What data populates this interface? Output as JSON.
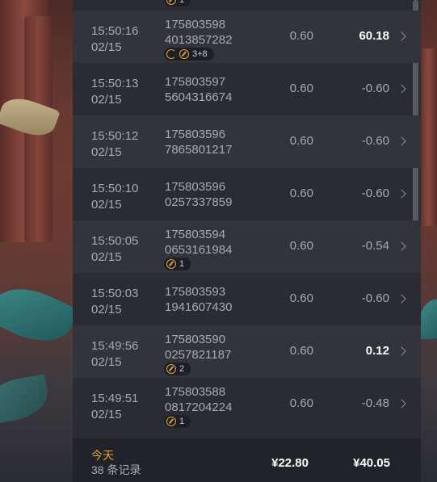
{
  "rows": [
    {
      "time": "15:50:16",
      "date": "02/15",
      "id_line1": "175803598",
      "id_line2": "4013857282",
      "bet": "0.60",
      "pl": "60.18",
      "pl_positive": true,
      "badge": "3+8",
      "badge_refresh": true
    },
    {
      "time": "15:50:13",
      "date": "02/15",
      "id_line1": "175803597",
      "id_line2": "5604316674",
      "bet": "0.60",
      "pl": "-0.60",
      "pl_positive": false
    },
    {
      "time": "15:50:12",
      "date": "02/15",
      "id_line1": "175803596",
      "id_line2": "7865801217",
      "bet": "0.60",
      "pl": "-0.60",
      "pl_positive": false
    },
    {
      "time": "15:50:10",
      "date": "02/15",
      "id_line1": "175803596",
      "id_line2": "0257337859",
      "bet": "0.60",
      "pl": "-0.60",
      "pl_positive": false
    },
    {
      "time": "15:50:05",
      "date": "02/15",
      "id_line1": "175803594",
      "id_line2": "0653161984",
      "bet": "0.60",
      "pl": "-0.54",
      "pl_positive": false,
      "badge": "1"
    },
    {
      "time": "15:50:03",
      "date": "02/15",
      "id_line1": "175803593",
      "id_line2": "1941607430",
      "bet": "0.60",
      "pl": "-0.60",
      "pl_positive": false
    },
    {
      "time": "15:49:56",
      "date": "02/15",
      "id_line1": "175803590",
      "id_line2": "0257821187",
      "bet": "0.60",
      "pl": "0.12",
      "pl_positive": true,
      "badge": "2"
    },
    {
      "time": "15:49:51",
      "date": "02/15",
      "id_line1": "175803588",
      "id_line2": "0817204224",
      "bet": "0.60",
      "pl": "-0.48",
      "pl_positive": false,
      "badge": "1"
    }
  ],
  "top_partial_badge": "1",
  "footer": {
    "day_label": "今天",
    "record_count": "38 条记录",
    "bet_total": "¥22.80",
    "pl_total": "¥40.05"
  },
  "colors": {
    "accent": "#e0a33a",
    "panel": "#2b2c33",
    "text": "#a8aab1"
  }
}
